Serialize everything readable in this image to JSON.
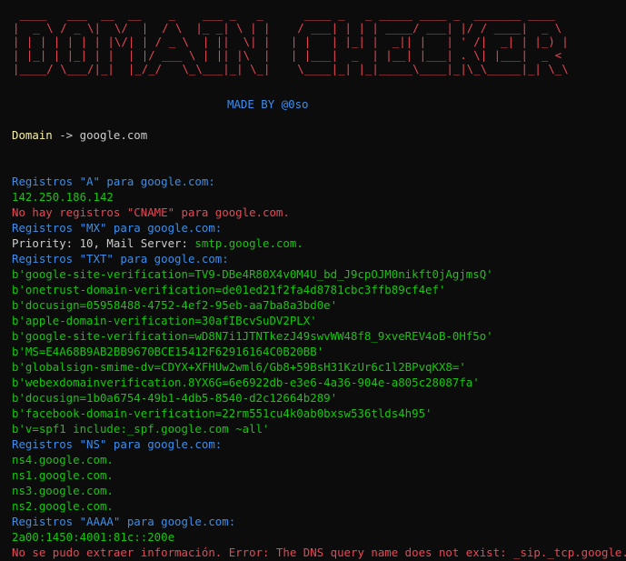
{
  "colors": {
    "background": "#0c0c0c",
    "banner": "#e74856",
    "heading": "#3b8eea",
    "value": "#16c60c",
    "error": "#e74856",
    "prompt": "#f9f1a5",
    "text": "#cccccc"
  },
  "banner_lines": [
    " ____   ___  __  __    _    ___ _   _      ____ _   _ _____ ____ _  _______ ____  ",
    "|  _ \\ / _ \\|  \\/  |  / \\  |_ _| \\ | |    / ___| | | | ____/ ___| |/ / ____|  _ \\ ",
    "| | | | | | | |\\/| | / _ \\  | ||  \\| |   | |   | |_| |  _|| |   | ' /|  _| | |_) |",
    "| |_| | |_| | |  | |/ ___ \\ | || |\\  |   | |___|  _  | |__| |___| . \\| |___|  _ < ",
    "|____/ \\___/|_|  |_/_/   \\_\\___|_| \\_|    \\____|_| |_|_____\\____|_|\\_\\_____|_| \\_\\"
  ],
  "made_by": "MADE BY @0so",
  "prompt": {
    "label": "Domain",
    "arrow": " -> ",
    "value": "google.com"
  },
  "sections": {
    "a_header": "Registros \"A\" para google.com:",
    "a_value": "142.250.186.142",
    "cname_error": "No hay registros \"CNAME\" para google.com.",
    "mx_header": "Registros \"MX\" para google.com:",
    "mx_priority_label": "Priority: 10, Mail Server: ",
    "mx_server": "smtp.google.com.",
    "txt_header": "Registros \"TXT\" para google.com:",
    "txt_records": [
      "b'google-site-verification=TV9-DBe4R80X4v0M4U_bd_J9cpOJM0nikft0jAgjmsQ'",
      "b'onetrust-domain-verification=de01ed21f2fa4d8781cbc3ffb89cf4ef'",
      "b'docusign=05958488-4752-4ef2-95eb-aa7ba8a3bd0e'",
      "b'apple-domain-verification=30afIBcvSuDV2PLX'",
      "b'google-site-verification=wD8N7i1JTNTkezJ49swvWW48f8_9xveREV4oB-0Hf5o'",
      "b'MS=E4A68B9AB2BB9670BCE15412F62916164C0B20BB'",
      "b'globalsign-smime-dv=CDYX+XFHUw2wml6/Gb8+59BsH31KzUr6c1l2BPvqKX8='",
      "b'webexdomainverification.8YX6G=6e6922db-e3e6-4a36-904e-a805c28087fa'",
      "b'docusign=1b0a6754-49b1-4db5-8540-d2c12664b289'",
      "b'facebook-domain-verification=22rm551cu4k0ab0bxsw536tlds4h95'",
      "b'v=spf1 include:_spf.google.com ~all'"
    ],
    "ns_header": "Registros \"NS\" para google.com:",
    "ns_records": [
      "ns4.google.com.",
      "ns1.google.com.",
      "ns3.google.com.",
      "ns2.google.com."
    ],
    "aaaa_header": "Registros \"AAAA\" para google.com:",
    "aaaa_value": "2a00:1450:4001:81c::200e",
    "srv_error": "No se pudo extraer información. Error: The DNS query name does not exist: _sip._tcp.google.com."
  }
}
